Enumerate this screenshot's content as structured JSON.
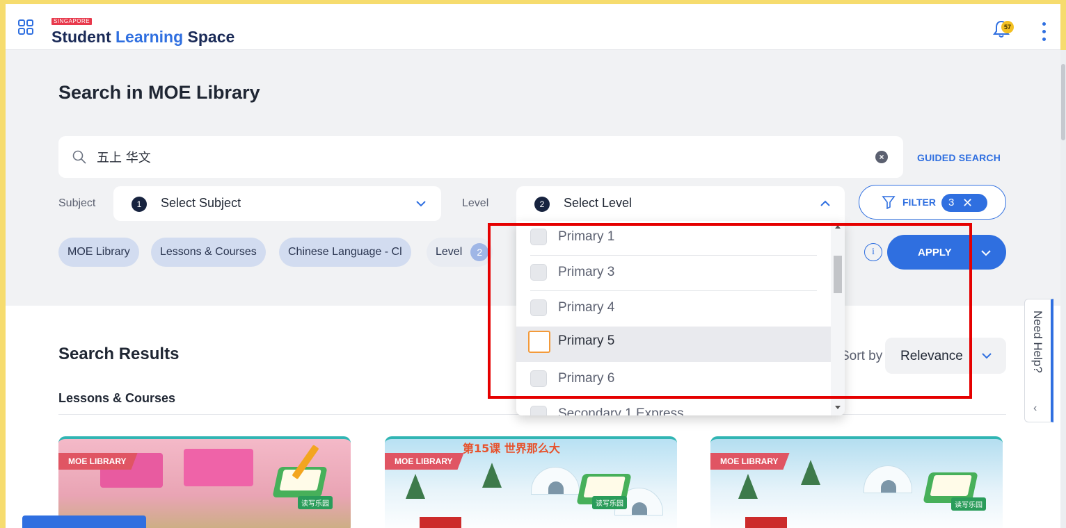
{
  "header": {
    "brand_tag": "SINGAPORE",
    "brand_word1": "Student",
    "brand_word2": "Learning",
    "brand_word3": "Space",
    "notification_count": "57"
  },
  "search": {
    "title": "Search in MOE Library",
    "query": "五上 华文",
    "guided_search_label": "GUIDED SEARCH"
  },
  "filters": {
    "subject_label": "Subject",
    "subject_count": "1",
    "subject_value": "Select Subject",
    "level_label": "Level",
    "level_count": "2",
    "level_value": "Select Level",
    "filter_label": "FILTER",
    "filter_count": "3",
    "apply_label": "APPLY",
    "info_glyph": "i"
  },
  "chips": [
    {
      "label": "MOE Library"
    },
    {
      "label": "Lessons & Courses"
    },
    {
      "label": "Chinese Language - Cl"
    },
    {
      "label": "Level",
      "count": "2"
    }
  ],
  "level_dropdown": {
    "options": [
      {
        "label": "Primary 1",
        "checked": false,
        "highlighted": false
      },
      {
        "label": "Primary 3",
        "checked": false,
        "highlighted": false
      },
      {
        "label": "Primary 4",
        "checked": false,
        "highlighted": false
      },
      {
        "label": "Primary 5",
        "checked": false,
        "highlighted": true
      },
      {
        "label": "Primary 6",
        "checked": false,
        "highlighted": false
      },
      {
        "label": "Secondary 1 Express",
        "checked": false,
        "highlighted": false
      }
    ]
  },
  "results": {
    "title": "Search Results",
    "section_label": "Lessons & Courses",
    "sort_label": "Sort by",
    "sort_value": "Relevance",
    "cards": [
      {
        "tag": "MOE LIBRARY",
        "title": "",
        "badge": "读写乐园"
      },
      {
        "tag": "MOE LIBRARY",
        "title": "第15课 世界那么大",
        "badge": "读写乐园"
      },
      {
        "tag": "MOE LIBRARY",
        "title": "",
        "badge": "读写乐园"
      }
    ]
  },
  "need_help": {
    "label": "Need Help?",
    "chevron": "‹"
  },
  "colors": {
    "accent": "#2f6fe0",
    "brand_dark": "#1a2a57",
    "highlight_box": "#e50000",
    "tag_red": "#e05563",
    "frame": "#f6dc6e"
  },
  "icons": [
    "apps-grid-icon",
    "bell-icon",
    "more-vertical-icon",
    "search-icon",
    "clear-icon",
    "chevron-down-icon",
    "chevron-up-icon",
    "filter-icon",
    "close-icon",
    "info-icon"
  ]
}
